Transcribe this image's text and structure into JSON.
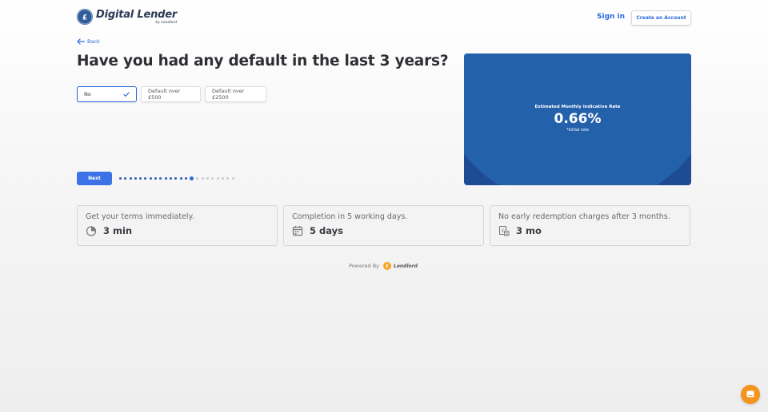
{
  "header": {
    "logo_title": "Digital Lender",
    "logo_sub": "by Lendlord",
    "signin_label": "Sign in",
    "create_account_label": "Create an Account"
  },
  "nav": {
    "back_label": "Back"
  },
  "question": "Have you had any default in the last 3 years?",
  "options": [
    {
      "label": "No",
      "selected": true
    },
    {
      "label": "Default over £500",
      "selected": false
    },
    {
      "label": "Default over £2500",
      "selected": false
    }
  ],
  "next_label": "Next",
  "progress": {
    "total_steps": 23,
    "current_step": 15
  },
  "rate_card": {
    "label": "Estimated Monthly Indicative Rate",
    "value": "0.66%",
    "note": "*Initial rate"
  },
  "features": [
    {
      "title": "Get your terms immediately.",
      "value": "3 min",
      "icon": "clock-icon"
    },
    {
      "title": "Completion in 5 working days.",
      "value": "5 days",
      "icon": "calendar-icon"
    },
    {
      "title": "No early redemption charges after 3 months.",
      "value": "3 mo",
      "icon": "document-pound-icon"
    }
  ],
  "footer": {
    "powered_by": "Powered By",
    "brand": "Lendlord",
    "coin_symbol": "£"
  },
  "colors": {
    "accent": "#2a6ad8",
    "card_bg": "#1d4c94",
    "chat": "#f5941d"
  }
}
